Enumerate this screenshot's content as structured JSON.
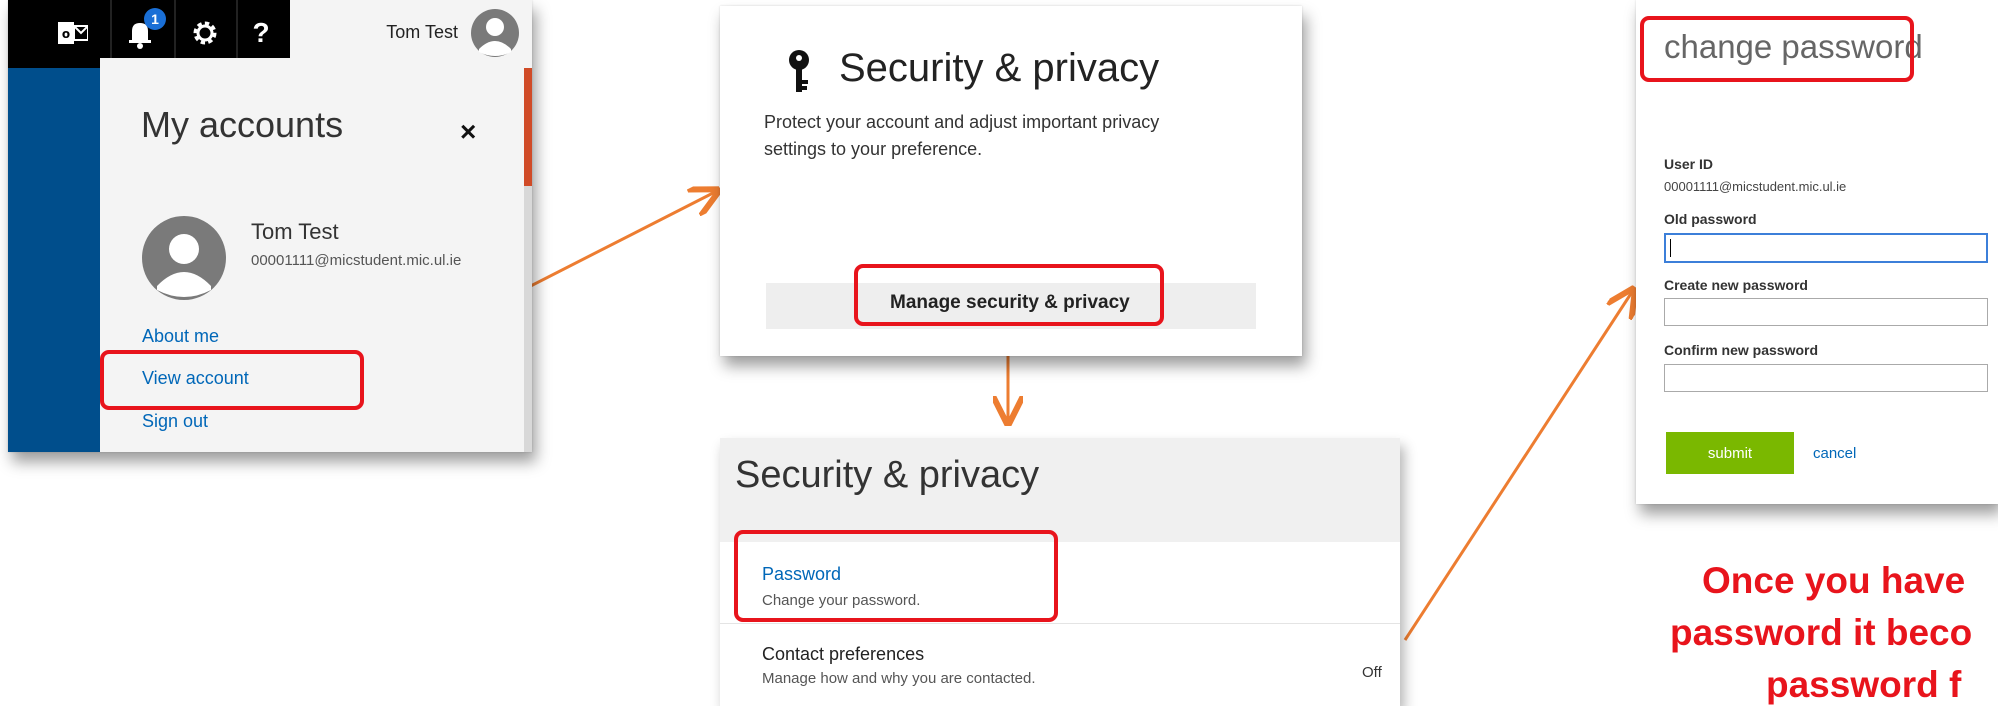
{
  "panel1": {
    "topbar": {
      "notification_count": "1"
    },
    "user_name_top": "Tom Test",
    "title": "My accounts",
    "close_glyph": "×",
    "account_name": "Tom Test",
    "account_email": "00001111@micstudent.mic.ul.ie",
    "links": [
      "About me",
      "View account",
      "Sign out"
    ]
  },
  "panel2": {
    "title": "Security & privacy",
    "description_line1": "Protect your account and adjust important privacy",
    "description_line2": "settings to your preference.",
    "manage_button": "Manage security & privacy"
  },
  "panel2b": {
    "title": "Security & privacy",
    "items": [
      {
        "label": "Password",
        "description": "Change your password.",
        "value": ""
      },
      {
        "label": "Contact preferences",
        "description": "Manage how and why you are contacted.",
        "value": "Off"
      }
    ]
  },
  "panel3": {
    "title": "change password",
    "user_id_label": "User ID",
    "user_id_value": "00001111@micstudent.mic.ul.ie",
    "fields": [
      {
        "label": "Old password",
        "value": ""
      },
      {
        "label": "Create new password",
        "value": ""
      },
      {
        "label": "Confirm new password",
        "value": ""
      }
    ],
    "submit_label": "submit",
    "cancel_label": "cancel"
  },
  "caption": {
    "line1": "Once you have",
    "line2": "password it beco",
    "line3": "password f"
  },
  "colors": {
    "highlight_red": "#e8141c",
    "arrow_orange": "#ed7d31",
    "link_blue": "#0067b8",
    "outlook_blue": "#004e8c",
    "submit_green": "#7ab800",
    "caption_red": "#e8141c"
  }
}
